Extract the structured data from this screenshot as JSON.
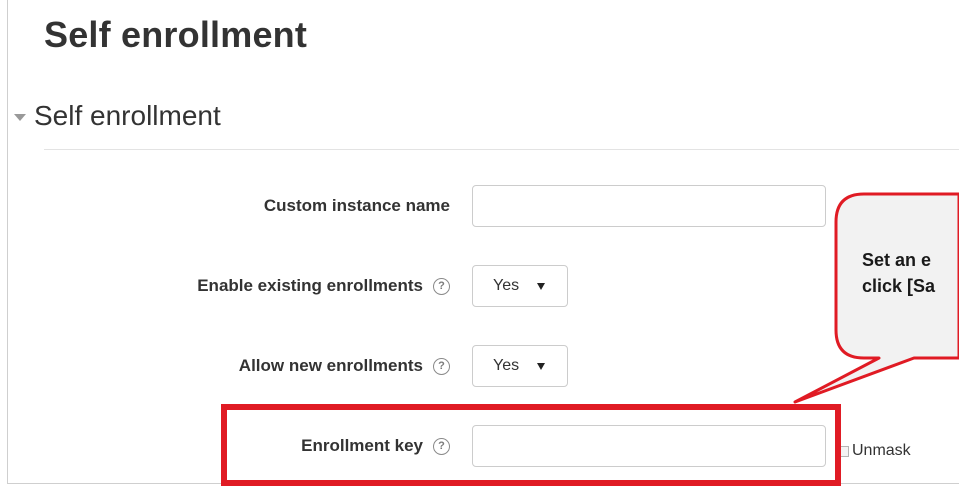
{
  "page": {
    "title": "Self enrollment"
  },
  "section": {
    "title": "Self enrollment"
  },
  "form": {
    "custom_instance_name": {
      "label": "Custom instance name",
      "value": ""
    },
    "enable_existing": {
      "label": "Enable existing enrollments",
      "help_icon": "help-question-icon",
      "selected": "Yes"
    },
    "allow_new": {
      "label": "Allow new enrollments",
      "help_icon": "help-question-icon",
      "selected": "Yes"
    },
    "enrollment_key": {
      "label": "Enrollment key",
      "help_icon": "help-question-icon",
      "value": "",
      "unmask_label": "Unmask",
      "unmask_checked": false
    }
  },
  "callout": {
    "line1": "Set an e",
    "line2": "click [Sa"
  },
  "colors": {
    "highlight": "#e01b24",
    "callout_fill": "#f2f2f2",
    "text": "#333333"
  }
}
